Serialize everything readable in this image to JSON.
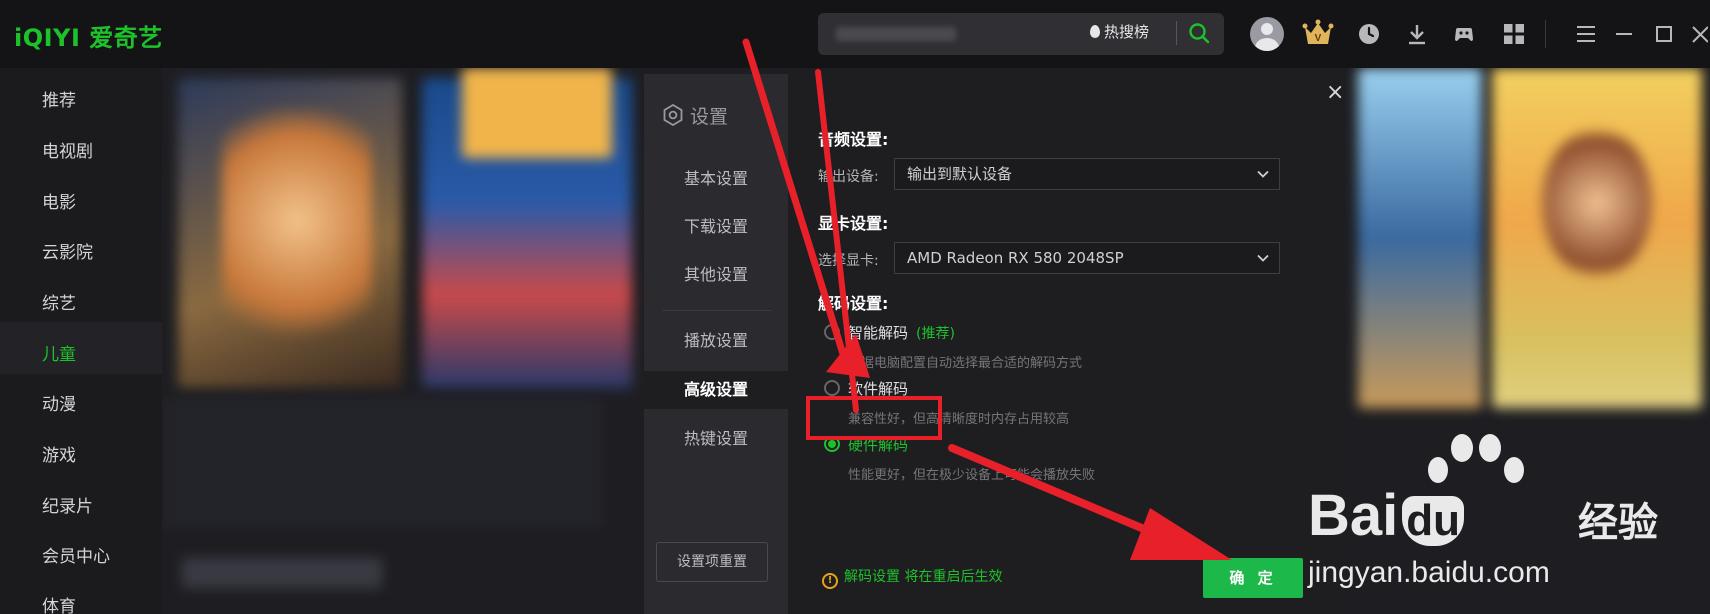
{
  "app": {
    "logo": "iQIYI 爱奇艺",
    "accent": "#1dc12a"
  },
  "search": {
    "hot_label": "热搜榜"
  },
  "sidebar": {
    "items": [
      {
        "label": "推荐"
      },
      {
        "label": "电视剧"
      },
      {
        "label": "电影"
      },
      {
        "label": "云影院"
      },
      {
        "label": "综艺"
      },
      {
        "label": "儿童",
        "active": true
      },
      {
        "label": "动漫"
      },
      {
        "label": "游戏"
      },
      {
        "label": "纪录片"
      },
      {
        "label": "会员中心"
      },
      {
        "label": "体育"
      }
    ]
  },
  "top_icons": [
    "user-avatar",
    "vip-crown-icon",
    "history-icon",
    "download-icon",
    "game-icon",
    "apps-icon",
    "menu-icon",
    "minimize-icon",
    "maximize-icon",
    "close-icon"
  ],
  "settings": {
    "title": "设置",
    "nav": [
      {
        "label": "基本设置"
      },
      {
        "label": "下载设置"
      },
      {
        "label": "其他设置"
      },
      {
        "label": "播放设置"
      },
      {
        "label": "高级设置",
        "active": true
      },
      {
        "label": "热键设置"
      }
    ],
    "reset_label": "设置项重置",
    "audio": {
      "title": "音频设置:",
      "label": "输出设备:",
      "value": "输出到默认设备"
    },
    "gpu": {
      "title": "显卡设置:",
      "label": "选择显卡:",
      "value": "AMD Radeon RX 580 2048SP"
    },
    "decode": {
      "title": "解码设置:",
      "options": [
        {
          "label": "智能解码",
          "tag": "(推荐)",
          "desc": "根据电脑配置自动选择最合适的解码方式",
          "checked": false
        },
        {
          "label": "软件解码",
          "desc": "兼容性好，但高清晰度时内存占用较高",
          "checked": false
        },
        {
          "label": "硬件解码",
          "desc": "性能更好，但在极少设备上可能会播放失败",
          "checked": true
        }
      ]
    },
    "notice_prefix": "解码设置",
    "notice_rest": " 将在重启后生效",
    "confirm_label": "确 定"
  },
  "watermark": {
    "brand": "Bai",
    "brand2": "du",
    "site_cn": "经验",
    "url": "jingyan.baidu.com"
  }
}
